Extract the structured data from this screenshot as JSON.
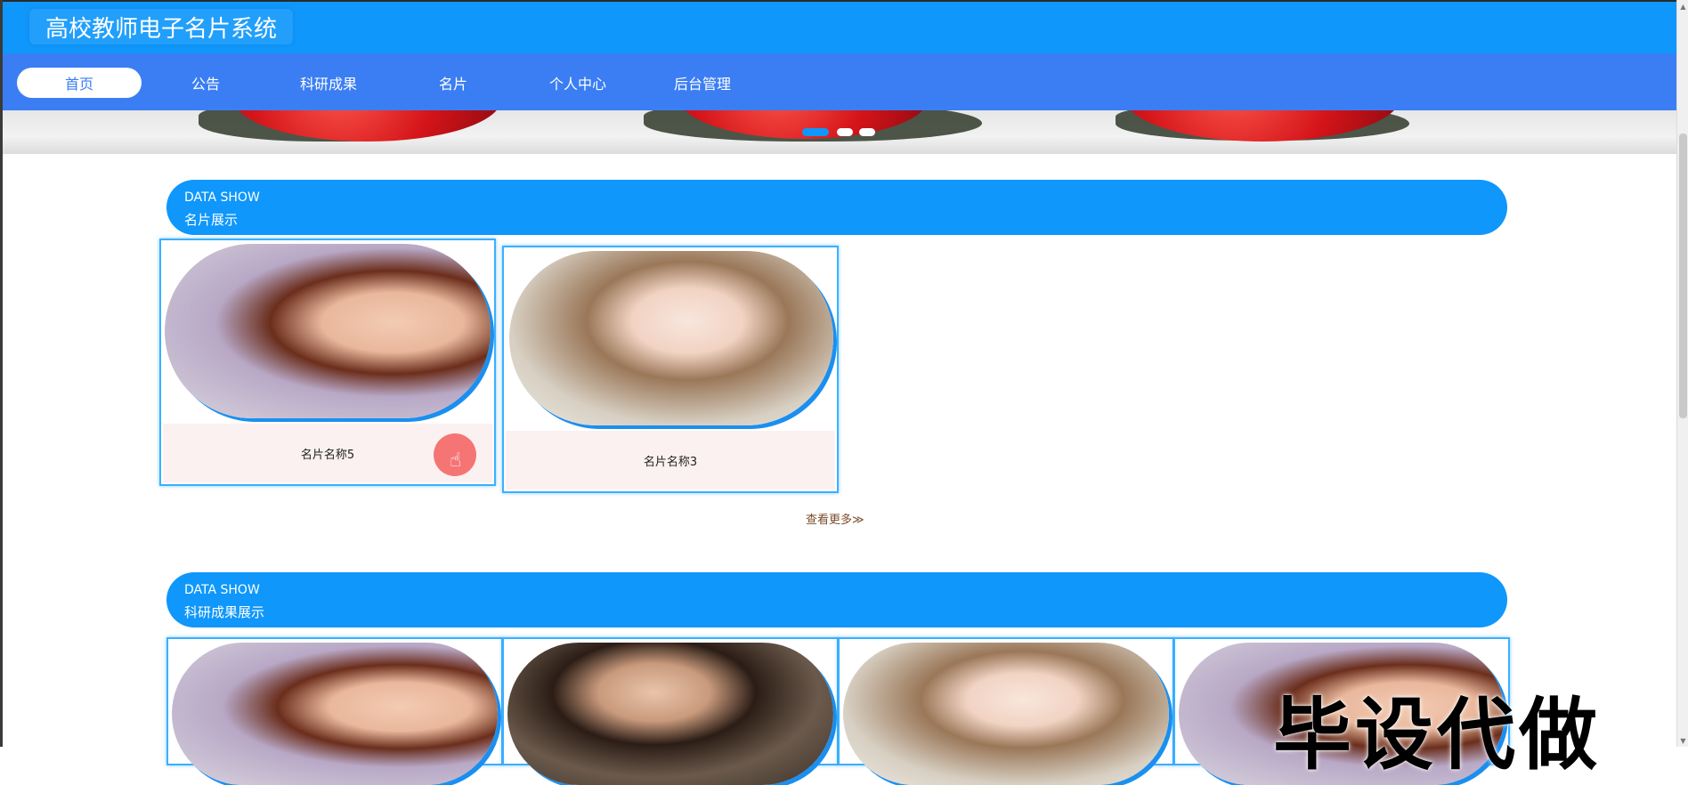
{
  "site": {
    "title": "高校教师电子名片系统"
  },
  "nav": {
    "items": [
      {
        "label": "首页",
        "active": true
      },
      {
        "label": "公告",
        "active": false
      },
      {
        "label": "科研成果",
        "active": false
      },
      {
        "label": "名片",
        "active": false
      },
      {
        "label": "个人中心",
        "active": false
      },
      {
        "label": "后台管理",
        "active": false
      }
    ]
  },
  "banner": {
    "dots": 3,
    "active_dot": 0
  },
  "section_cards": {
    "en_label": "DATA SHOW",
    "title": "名片展示",
    "cards": [
      {
        "label": "名片名称5"
      },
      {
        "label": "名片名称3"
      }
    ],
    "more_link": "查看更多≫"
  },
  "section_research": {
    "en_label": "DATA SHOW",
    "title": "科研成果展示"
  },
  "watermark": "毕设代做",
  "colors": {
    "title_bar": "#0f97fb",
    "nav_bar": "#3b7ef3",
    "section_header": "#0f97fb",
    "card_border": "#3ab0ff",
    "card_label_bg": "#fbf1f0"
  }
}
